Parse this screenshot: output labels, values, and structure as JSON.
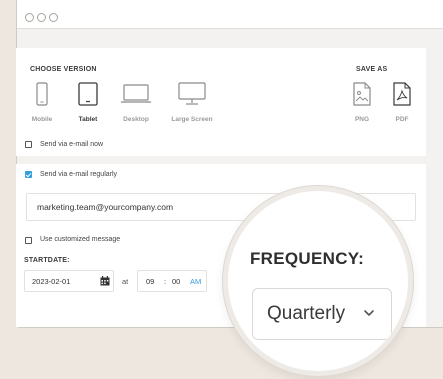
{
  "versions": {
    "title": "CHOOSE VERSION",
    "options": [
      {
        "label": "Mobile",
        "icon": "mobile-icon"
      },
      {
        "label": "Tablet",
        "icon": "tablet-icon",
        "selected": true
      },
      {
        "label": "Desktop",
        "icon": "desktop-icon"
      },
      {
        "label": "Large Screen",
        "icon": "large-screen-icon"
      }
    ]
  },
  "save_as": {
    "title": "SAVE AS",
    "options": [
      {
        "label": "PNG",
        "icon": "png-file-icon"
      },
      {
        "label": "PDF",
        "icon": "pdf-file-icon"
      }
    ]
  },
  "send_now": {
    "label": "Send via e-mail now",
    "checked": false
  },
  "send_regular": {
    "label": "Send via e-mail regularly",
    "checked": true
  },
  "email": {
    "value": "marketing.team@yourcompany.com"
  },
  "custom_message": {
    "label": "Use customized message",
    "checked": false
  },
  "start": {
    "label": "STARTDATE:",
    "date": "2023-02-01",
    "at": "at",
    "hour": "09",
    "sep": ":",
    "minute": "00",
    "ampm": "AM"
  },
  "frequency": {
    "label": "FREQUENCY:",
    "value": "Quarterly"
  },
  "colors": {
    "accent": "#2f9fe0",
    "background": "#ede7df"
  }
}
